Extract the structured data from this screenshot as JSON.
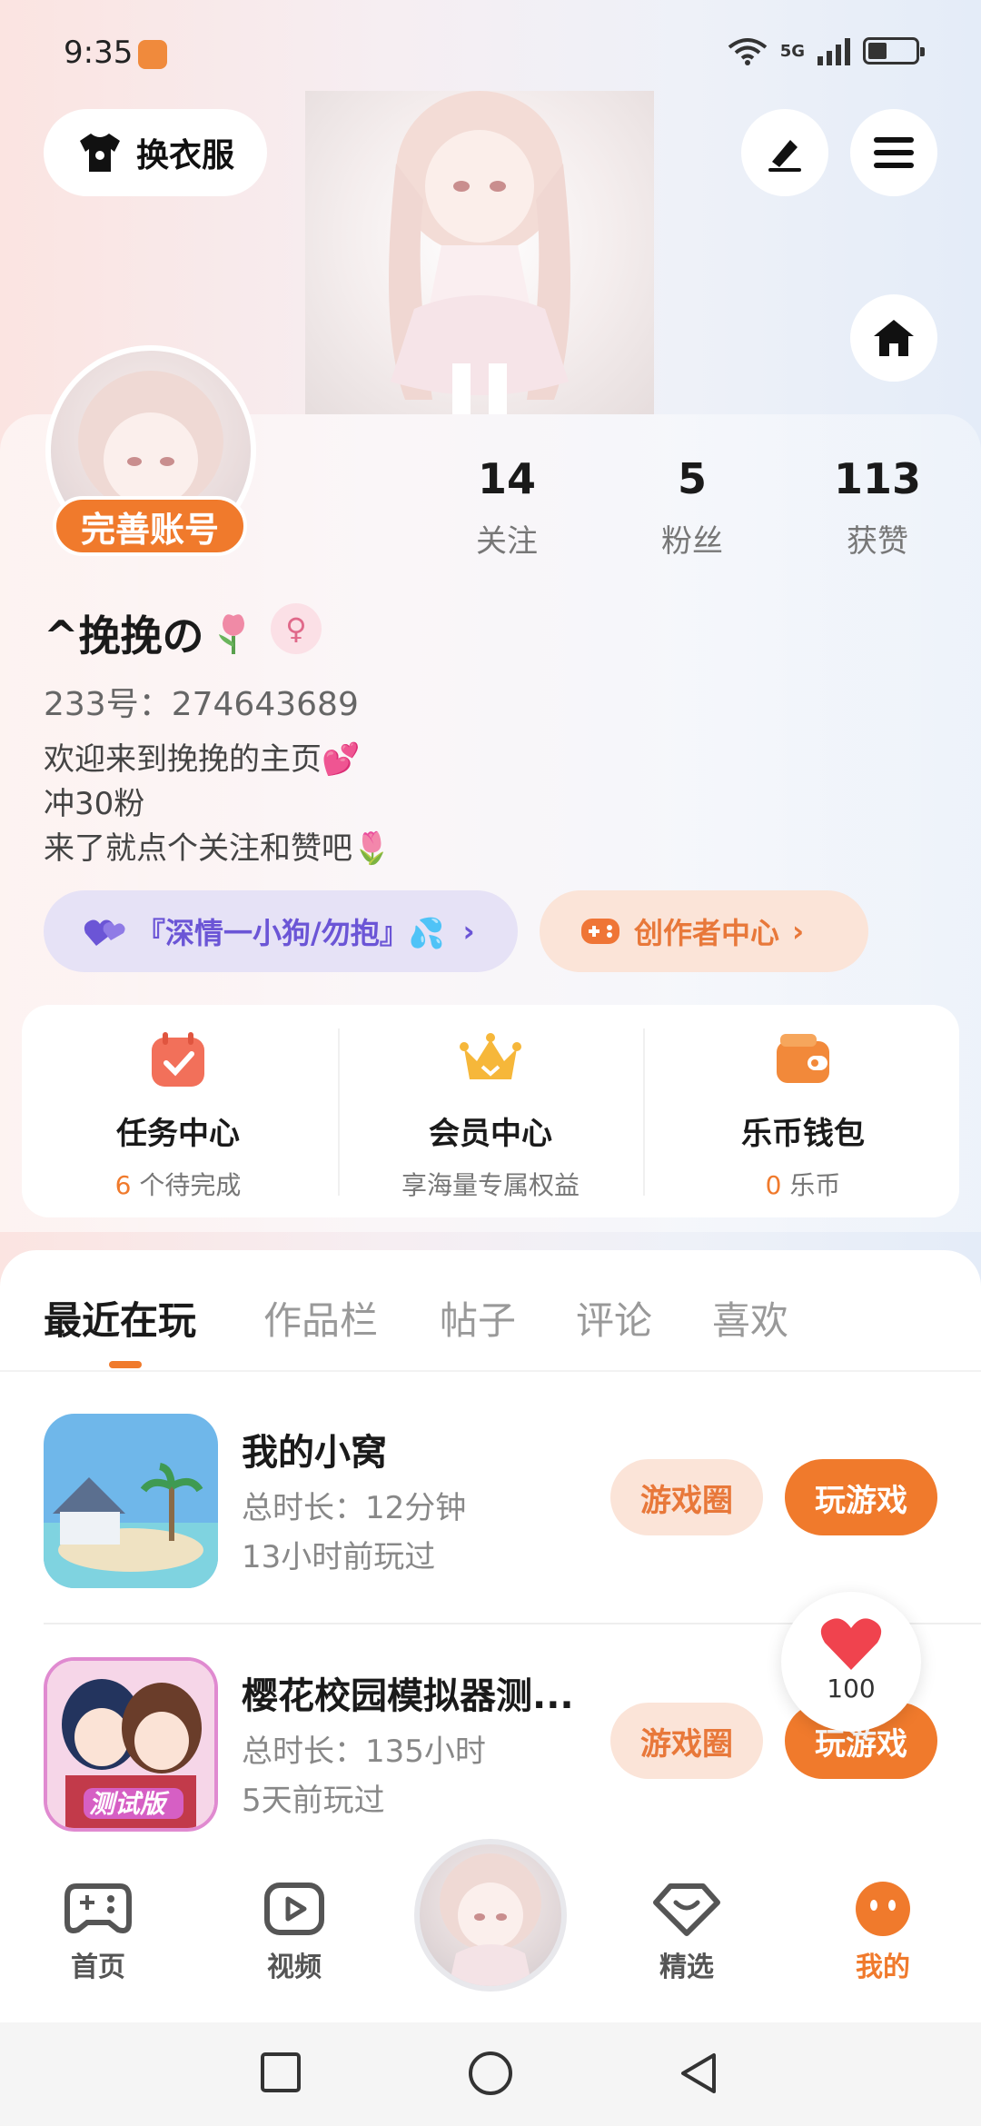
{
  "status_bar": {
    "time": "9:35",
    "network": "5G"
  },
  "header": {
    "change_outfit_label": "换衣服",
    "edit_label": "",
    "menu_label": ""
  },
  "profile": {
    "complete_account_label": "完善账号",
    "stats": [
      {
        "value": "14",
        "label": "关注"
      },
      {
        "value": "5",
        "label": "粉丝"
      },
      {
        "value": "113",
        "label": "获赞"
      }
    ],
    "username": "^挽挽の",
    "gender_symbol": "♀",
    "uid": "233号：274643689",
    "bio": [
      "欢迎来到挽挽的主页💕",
      "冲30粉",
      "来了就点个关注和赞吧🌷"
    ],
    "tag_family": "『深情一小狗/勿抱』💦",
    "tag_creator": "创作者中心"
  },
  "quick_actions": [
    {
      "title": "任务中心",
      "count": "6",
      "sub": " 个待完成"
    },
    {
      "title": "会员中心",
      "count": "",
      "sub": "享海量专属权益"
    },
    {
      "title": "乐币钱包",
      "count": "0",
      "sub": " 乐币"
    }
  ],
  "tabs": [
    "最近在玩",
    "作品栏",
    "帖子",
    "评论",
    "喜欢"
  ],
  "games": [
    {
      "title": "我的小窝",
      "duration": "总时长：12分钟",
      "last_played": "13小时前玩过",
      "circle_label": "游戏圈",
      "play_label": "玩游戏"
    },
    {
      "title": "樱花校园模拟器测...",
      "duration": "总时长：135小时",
      "last_played": "5天前玩过",
      "circle_label": "游戏圈",
      "play_label": "玩游戏",
      "icon_text": "测试版"
    }
  ],
  "like_bubble": {
    "count": "100"
  },
  "bottom_nav": [
    {
      "label": "首页"
    },
    {
      "label": "视频"
    },
    {
      "label": "精选"
    },
    {
      "label": "我的"
    }
  ],
  "colors": {
    "accent": "#f07a2c",
    "purple": "#6b55d6"
  }
}
